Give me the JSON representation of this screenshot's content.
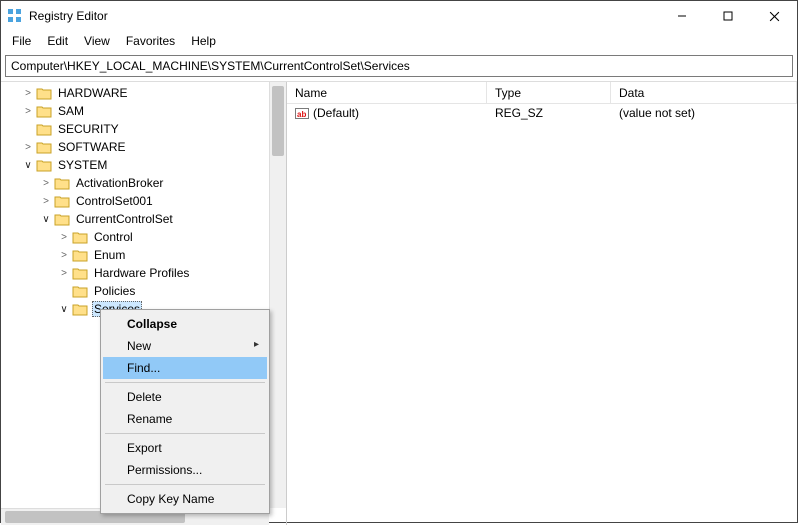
{
  "window": {
    "title": "Registry Editor"
  },
  "menu": {
    "file": "File",
    "edit": "Edit",
    "view": "View",
    "favorites": "Favorites",
    "help": "Help"
  },
  "address": "Computer\\HKEY_LOCAL_MACHINE\\SYSTEM\\CurrentControlSet\\Services",
  "tree": {
    "hardware": "HARDWARE",
    "sam": "SAM",
    "security": "SECURITY",
    "software": "SOFTWARE",
    "system": "SYSTEM",
    "activationbroker": "ActivationBroker",
    "controlset001": "ControlSet001",
    "currentcontrolset": "CurrentControlSet",
    "control": "Control",
    "enum": "Enum",
    "hwprofiles": "Hardware Profiles",
    "policies": "Policies",
    "services": "Services"
  },
  "columns": {
    "name": "Name",
    "type": "Type",
    "data": "Data"
  },
  "values": [
    {
      "icon_text": "ab",
      "name": "(Default)",
      "type": "REG_SZ",
      "data": "(value not set)"
    }
  ],
  "context_menu": {
    "collapse": "Collapse",
    "new": "New",
    "find": "Find...",
    "delete": "Delete",
    "rename": "Rename",
    "export": "Export",
    "permissions": "Permissions...",
    "copy_key_name": "Copy Key Name"
  }
}
